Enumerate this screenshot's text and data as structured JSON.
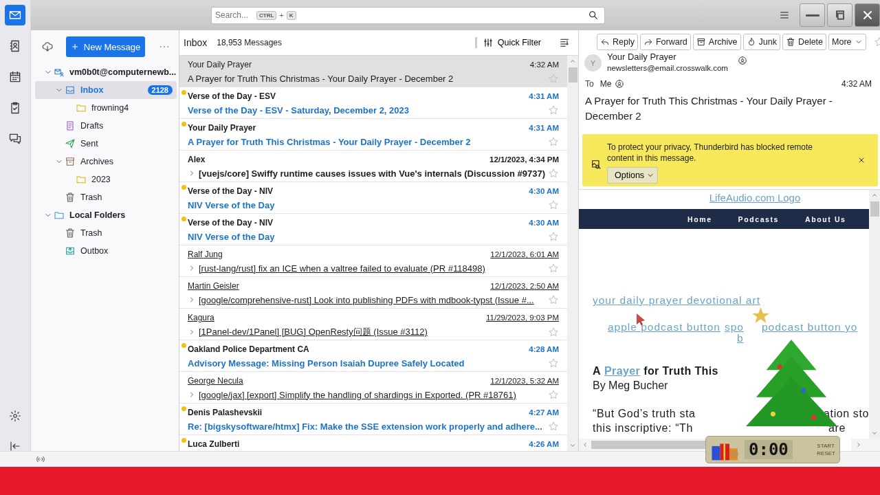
{
  "spaces": [
    {
      "kind": "mail",
      "selected": true
    },
    {
      "kind": "contacts",
      "selected": false
    },
    {
      "kind": "calendar",
      "selected": false
    },
    {
      "kind": "tasks",
      "selected": false
    },
    {
      "kind": "chat",
      "selected": false
    }
  ],
  "search": {
    "placeholder": "Search...",
    "keys": [
      "CTRL",
      "+",
      "K"
    ]
  },
  "folder_pane": {
    "new_message": "New Message"
  },
  "folders": [
    {
      "kind": "account",
      "name": "vm0b0t@computernewb...",
      "selected": false,
      "expanded": true,
      "children": [
        {
          "kind": "inbox",
          "name": "Inbox",
          "count": "2128",
          "selected": true,
          "expanded": true,
          "children": [
            {
              "kind": "folder",
              "name": "frowning4",
              "selected": false
            }
          ]
        },
        {
          "kind": "drafts",
          "name": "Drafts",
          "selected": false
        },
        {
          "kind": "sent",
          "name": "Sent",
          "selected": false
        },
        {
          "kind": "archive",
          "name": "Archives",
          "selected": false,
          "expanded": true,
          "children": [
            {
              "kind": "folder",
              "name": "2023",
              "selected": false
            }
          ]
        },
        {
          "kind": "trash",
          "name": "Trash",
          "selected": false
        }
      ]
    },
    {
      "kind": "local",
      "name": "Local Folders",
      "selected": false,
      "expanded": true,
      "children": [
        {
          "kind": "trash",
          "name": "Trash",
          "selected": false
        },
        {
          "kind": "outbox",
          "name": "Outbox",
          "selected": false
        }
      ]
    }
  ],
  "list_header": {
    "folder": "Inbox",
    "count": "18,953 Messages",
    "quick_filter": "Quick Filter"
  },
  "messages": [
    {
      "sender": "Your Daily Prayer",
      "subject": "A Prayer for Truth This Christmas - Your Daily Prayer - December 2",
      "time": "4:32 AM",
      "selected": true,
      "unread": false,
      "new": false,
      "thread": false
    },
    {
      "sender": "Verse of the Day - ESV",
      "subject": "Verse of the Day - ESV - Saturday, December 2, 2023",
      "time": "4:31 AM",
      "selected": false,
      "unread": true,
      "new": true,
      "thread": false
    },
    {
      "sender": "Your Daily Prayer",
      "subject": "A Prayer for Truth This Christmas - Your Daily Prayer - December 2",
      "time": "4:31 AM",
      "selected": false,
      "unread": true,
      "new": true,
      "thread": false
    },
    {
      "sender": "Alex",
      "subject": "[vuejs/core] Swiffy runtime causes issues with Vue's internals (Discussion #9737)",
      "time": "12/1/2023, 4:34 PM",
      "selected": false,
      "unread": true,
      "new": false,
      "thread": true
    },
    {
      "sender": "Verse of the Day - NIV",
      "subject": "NIV Verse of the Day",
      "time": "4:30 AM",
      "selected": false,
      "unread": true,
      "new": true,
      "thread": false
    },
    {
      "sender": "Verse of the Day - NIV",
      "subject": "NIV Verse of the Day",
      "time": "4:30 AM",
      "selected": false,
      "unread": true,
      "new": true,
      "thread": false
    },
    {
      "sender": "Ralf Jung",
      "subject": "[rust-lang/rust] fix an ICE when a valtree failed to evaluate (PR #118498)",
      "time": "12/1/2023, 6:01 AM",
      "selected": false,
      "unread": false,
      "new": false,
      "thread": true
    },
    {
      "sender": "Martin Geisler",
      "subject": "[google/comprehensive-rust] Look into publishing PDFs with mdbook-typst (Issue #...",
      "time": "12/1/2023, 2:50 AM",
      "selected": false,
      "unread": false,
      "new": false,
      "thread": true
    },
    {
      "sender": "Kagura",
      "subject": "[1Panel-dev/1Panel] [BUG] OpenResty问题 (Issue #3112)",
      "time": "11/29/2023, 9:03 PM",
      "selected": false,
      "unread": false,
      "new": false,
      "thread": true
    },
    {
      "sender": "Oakland Police Department CA",
      "subject": "Advisory Message: Missing Person Isaiah Dupree Safely Located",
      "time": "4:28 AM",
      "selected": false,
      "unread": true,
      "new": true,
      "thread": false
    },
    {
      "sender": "George Necula",
      "subject": "[google/jax] [export] Simplify the handling of shardings in Exported. (PR #18761)",
      "time": "12/1/2023, 5:32 AM",
      "selected": false,
      "unread": false,
      "new": false,
      "thread": true
    },
    {
      "sender": "Denis Palashevskii",
      "subject": "Re: [bigskysoftware/htmx] Fix: Make the SSE extension work properly and adhere...",
      "time": "4:27 AM",
      "selected": false,
      "unread": true,
      "new": true,
      "thread": false
    },
    {
      "sender": "Luca Zulberti",
      "time": "4:26 AM",
      "selected": false,
      "unread": true,
      "new": true,
      "thread": false
    }
  ],
  "reader": {
    "actions": [
      {
        "kind": "reply",
        "label": "Reply"
      },
      {
        "kind": "forward",
        "label": "Forward"
      },
      {
        "kind": "archive",
        "label": "Archive"
      },
      {
        "kind": "junk",
        "label": "Junk"
      },
      {
        "kind": "delete",
        "label": "Delete"
      },
      {
        "kind": "more",
        "label": "More"
      }
    ],
    "avatar": "Y",
    "from_name": "Your Daily Prayer",
    "from_email": "newsletters@email.crosswalk.com",
    "to_label": "To",
    "to": "Me",
    "time": "4:32 AM",
    "subject": "A Prayer for Truth This Christmas - Your Daily Prayer - December 2",
    "notice": {
      "text": "To protect your privacy, Thunderbird has blocked remote content in this message.",
      "button": "Options"
    },
    "body": {
      "logo_link": "LifeAudio.com Logo",
      "nav": [
        "Home",
        "Podcasts",
        "About Us"
      ],
      "art_link": "your daily prayer devotional art",
      "podcast_links": [
        "apple podcast button",
        "spo",
        "podcast button yo"
      ],
      "podcast_line2": "b",
      "heading": {
        "prefix": "A",
        "link": "Prayer",
        "suffix": "for Truth This"
      },
      "byline": "By Meg Bucher",
      "lines": [
        {
          "left": "“But God’s truth sta",
          "right": "ation sto"
        },
        {
          "left": "this inscriptive: “Th",
          "right": "are"
        }
      ]
    }
  },
  "widget": {
    "display": "0:00",
    "buttons": [
      "START",
      "RESET"
    ]
  }
}
